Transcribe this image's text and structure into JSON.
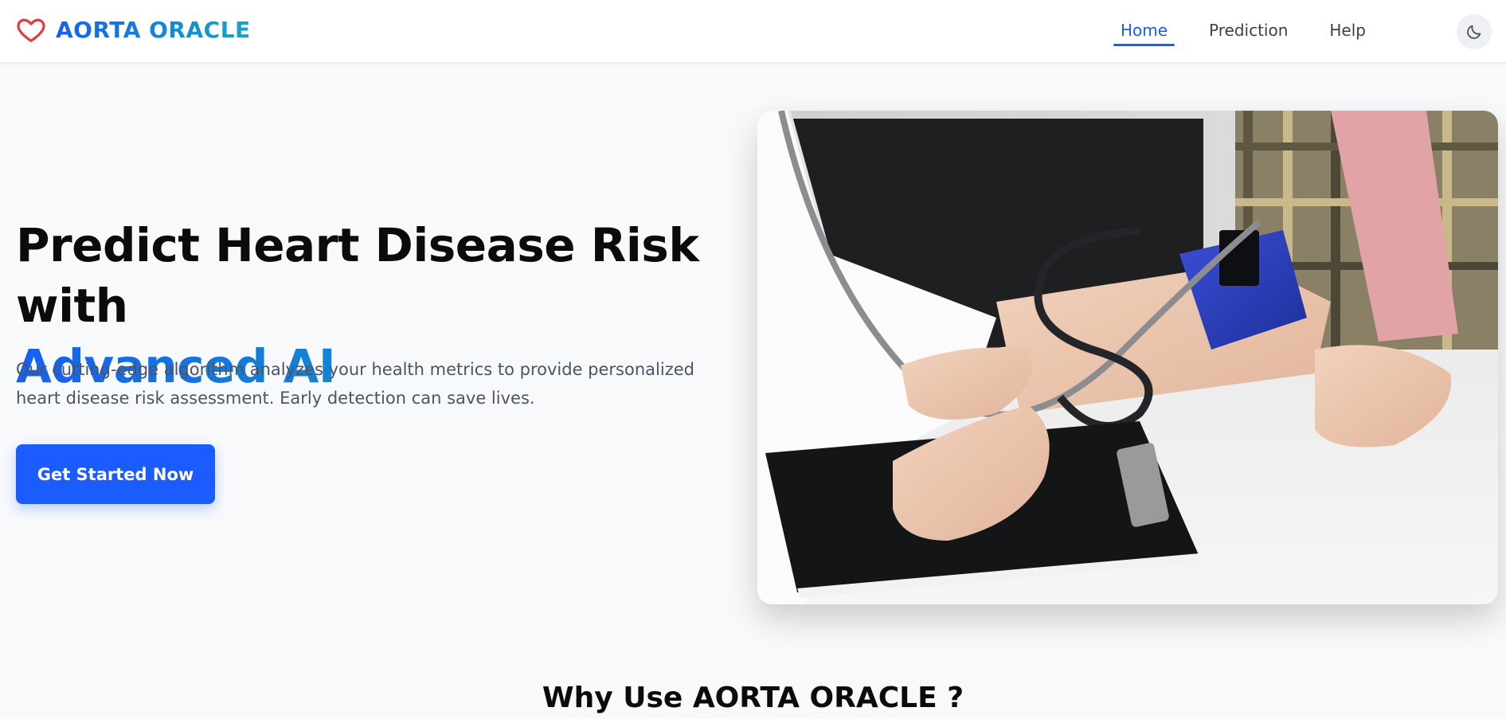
{
  "brand": {
    "name": "AORTA ORACLE",
    "icon": "heart-outline-icon",
    "icon_color": "#e23b3b",
    "gradient_start": "#1560f0",
    "gradient_end": "#12a6c6"
  },
  "nav": {
    "items": [
      {
        "label": "Home",
        "active": true
      },
      {
        "label": "Prediction",
        "active": false
      },
      {
        "label": "Help",
        "active": false
      }
    ],
    "theme_toggle_icon": "moon-icon",
    "accent": "#1560f0"
  },
  "hero": {
    "title_line1": "Predict Heart Disease Risk with",
    "title_line2": "Advanced AI",
    "description": "Our cutting-edge algorithm analyzes your health metrics to provide personalized heart disease risk assessment. Early detection can save lives.",
    "cta_label": "Get Started Now",
    "cta_color": "#1a5cff",
    "image_alt": "Doctor measuring a patient's blood pressure"
  },
  "section": {
    "title": "Why Use AORTA ORACLE ?"
  }
}
